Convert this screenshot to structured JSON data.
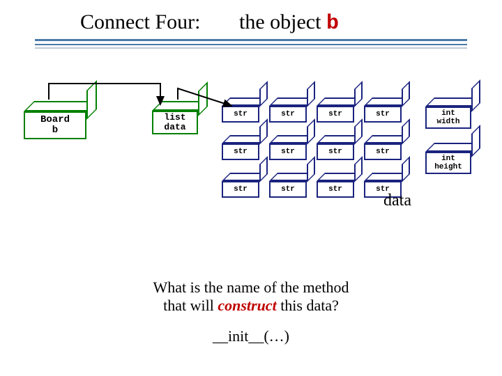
{
  "title": {
    "main": "Connect Four:",
    "sub": "the object",
    "code": "b"
  },
  "boxes": {
    "board_line1": "Board",
    "board_line2": "b",
    "listdata_line1": "list",
    "listdata_line2": "data",
    "int_width_line1": "int",
    "int_width_line2": "width",
    "int_height_line1": "int",
    "int_height_line2": "height"
  },
  "chart_data": {
    "type": "table",
    "cell_label": "str",
    "rows": 3,
    "cols": 4,
    "grid": [
      [
        "str",
        "str",
        "str",
        "str"
      ],
      [
        "str",
        "str",
        "str",
        "str"
      ],
      [
        "str",
        "str",
        "str",
        "str"
      ]
    ]
  },
  "data_label": "data",
  "question": {
    "line1": "What is the name of the method",
    "line2_prefix": "that will ",
    "line2_em": "construct",
    "line2_suffix": " this data?"
  },
  "answer": "__init__(…)"
}
